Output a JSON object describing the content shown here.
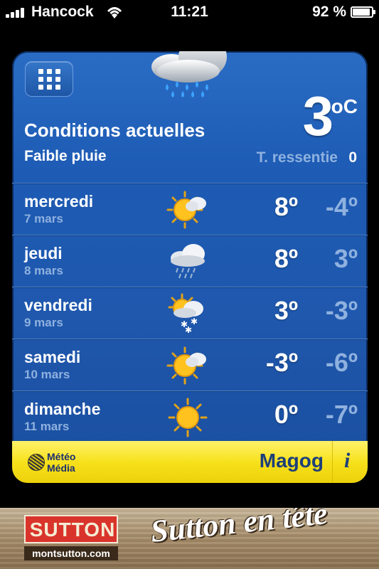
{
  "status_bar": {
    "carrier": "Hancock",
    "time": "11:21",
    "battery_percent": "92 %",
    "battery_level": 0.92
  },
  "current": {
    "label": "Conditions actuelles",
    "description": "Faible pluie",
    "temperature": "3",
    "unit": "oC",
    "feels_like_label": "T. ressentie",
    "feels_like_value": "0",
    "icon": "rain-cloud-icon"
  },
  "forecast": [
    {
      "day": "mercredi",
      "date": "7 mars",
      "high": "8º",
      "low": "-4º",
      "icon": "sun-cloud-icon"
    },
    {
      "day": "jeudi",
      "date": "8 mars",
      "high": "8º",
      "low": "3º",
      "icon": "rain-cloud-icon"
    },
    {
      "day": "vendredi",
      "date": "9 mars",
      "high": "3º",
      "low": "-3º",
      "icon": "sun-cloud-snow-icon"
    },
    {
      "day": "samedi",
      "date": "10 mars",
      "high": "-3º",
      "low": "-6º",
      "icon": "sun-cloud-icon"
    },
    {
      "day": "dimanche",
      "date": "11 mars",
      "high": "0º",
      "low": "-7º",
      "icon": "sun-icon"
    }
  ],
  "footer": {
    "logo_line1": "Météo",
    "logo_line2": "Média",
    "city": "Magog",
    "info": "i"
  },
  "ad": {
    "brand": "SUTTON",
    "url": "montsutton.com",
    "slogan": "Sutton en tête"
  },
  "colors": {
    "card_blue": "#1f58ad",
    "footer_yellow": "#f7e11c",
    "muted_blue_text": "#8fb1df",
    "city_text": "#1d3f7a"
  }
}
